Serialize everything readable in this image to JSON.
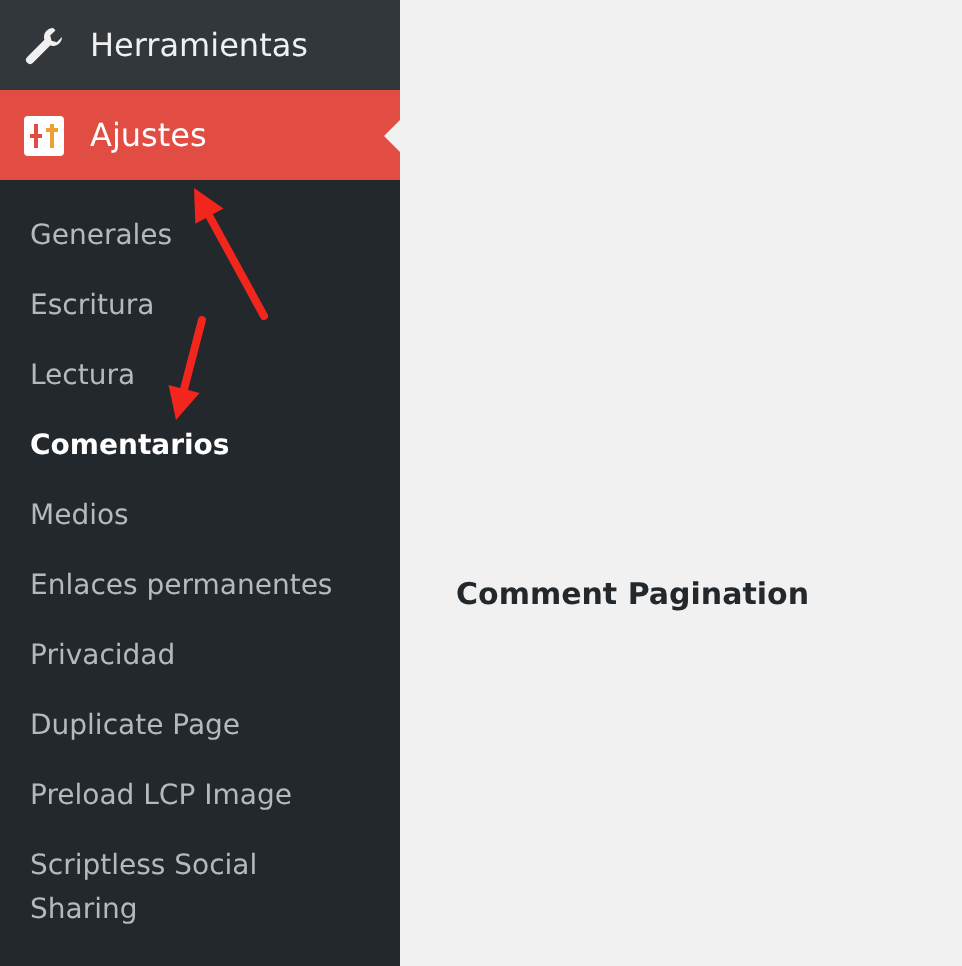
{
  "sidebar": {
    "items": [
      {
        "label": "Herramientas",
        "selected": false
      },
      {
        "label": "Ajustes",
        "selected": true,
        "submenu": [
          {
            "label": "Generales",
            "selected": false
          },
          {
            "label": "Escritura",
            "selected": false
          },
          {
            "label": "Lectura",
            "selected": false
          },
          {
            "label": "Comentarios",
            "selected": true
          },
          {
            "label": "Medios",
            "selected": false
          },
          {
            "label": "Enlaces permanentes",
            "selected": false
          },
          {
            "label": "Privacidad",
            "selected": false
          },
          {
            "label": "Duplicate Page",
            "selected": false
          },
          {
            "label": "Preload LCP Image",
            "selected": false
          },
          {
            "label": "Scriptless Social Sharing",
            "selected": false
          }
        ]
      }
    ]
  },
  "main": {
    "heading": "Comment Pagination"
  },
  "annotations": [
    {
      "kind": "arrow"
    },
    {
      "kind": "arrow"
    }
  ]
}
